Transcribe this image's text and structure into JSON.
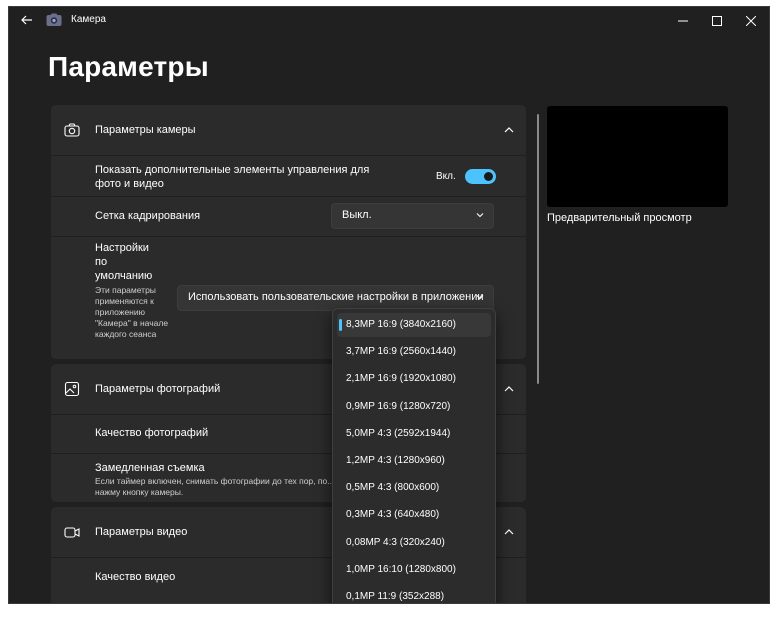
{
  "window": {
    "title": "Камера",
    "page_title": "Параметры"
  },
  "camera_settings": {
    "header": "Параметры камеры",
    "show_controls": {
      "label": "Показать дополнительные элементы управления для фото и видео",
      "state_label": "Вкл.",
      "on": true
    },
    "framing_grid": {
      "label": "Сетка кадрирования",
      "value": "Выкл."
    },
    "defaults": {
      "label": "Настройки по умолчанию",
      "description": "Эти параметры применяются к приложению \"Камера\" в начале каждого сеанса",
      "value": "Использовать пользовательские настройки в приложении"
    }
  },
  "photo_settings": {
    "header": "Параметры фотографий",
    "quality": {
      "label": "Качество фотографий"
    },
    "time_lapse": {
      "label": "Замедленная съемка",
      "description": "Если таймер включен, снимать фотографии до тех пор, по... нажму кнопку камеры."
    }
  },
  "video_settings": {
    "header": "Параметры видео",
    "quality": {
      "label": "Качество видео"
    }
  },
  "preview": {
    "label": "Предварительный просмотр"
  },
  "quality_dropdown": {
    "selected_index": 0,
    "options": [
      "8,3MP 16:9 (3840x2160)",
      "3,7MP 16:9 (2560x1440)",
      "2,1MP 16:9 (1920x1080)",
      "0,9MP 16:9 (1280x720)",
      "5,0MP 4:3 (2592x1944)",
      "1,2MP 4:3 (1280x960)",
      "0,5MP 4:3 (800x600)",
      "0,3MP 4:3 (640x480)",
      "0,08MP 4:3 (320x240)",
      "1,0MP 16:10 (1280x800)",
      "0,1MP 11:9 (352x288)"
    ]
  },
  "colors": {
    "accent": "#4cc2ff",
    "window_bg": "#202020",
    "card_bg": "#2b2b2b"
  }
}
